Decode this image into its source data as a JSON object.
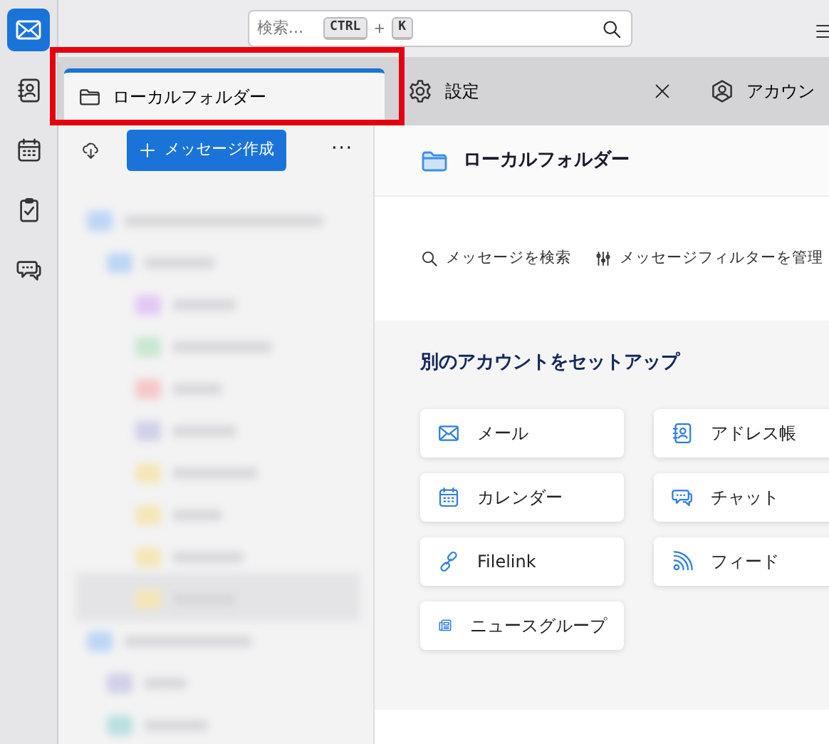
{
  "spaces": [
    {
      "kind": "mail",
      "selected": true
    },
    {
      "kind": "addressbook",
      "selected": false
    },
    {
      "kind": "calendar",
      "selected": false
    },
    {
      "kind": "tasks",
      "selected": false
    },
    {
      "kind": "chat",
      "selected": false
    }
  ],
  "search": {
    "placeholder": "検索...",
    "keys": [
      "CTRL",
      "K"
    ],
    "joiner": "+"
  },
  "tabs": [
    {
      "label": "ローカルフォルダー",
      "kind": "folder",
      "selected": true,
      "closable": false
    },
    {
      "label": "設定",
      "kind": "gear",
      "selected": false,
      "closable": true
    },
    {
      "label": "アカウン",
      "kind": "account",
      "selected": false,
      "closable": false
    }
  ],
  "folder_pane": {
    "compose": "メッセージ作成",
    "more": "···"
  },
  "content": {
    "title": "ローカルフォルダー",
    "actions": [
      {
        "kind": "search",
        "label": "メッセージを検索"
      },
      {
        "kind": "filter",
        "label": "メッセージフィルターを管理"
      }
    ],
    "setup_heading": "別のアカウントをセットアップ",
    "setup_items": [
      {
        "kind": "mail",
        "label": "メール"
      },
      {
        "kind": "addressbook",
        "label": "アドレス帳"
      },
      {
        "kind": "calendar",
        "label": "カレンダー"
      },
      {
        "kind": "chat",
        "label": "チャット"
      },
      {
        "kind": "link",
        "label": "Filelink"
      },
      {
        "kind": "feed",
        "label": "フィード"
      },
      {
        "kind": "news",
        "label": "ニュースグループ"
      }
    ]
  }
}
